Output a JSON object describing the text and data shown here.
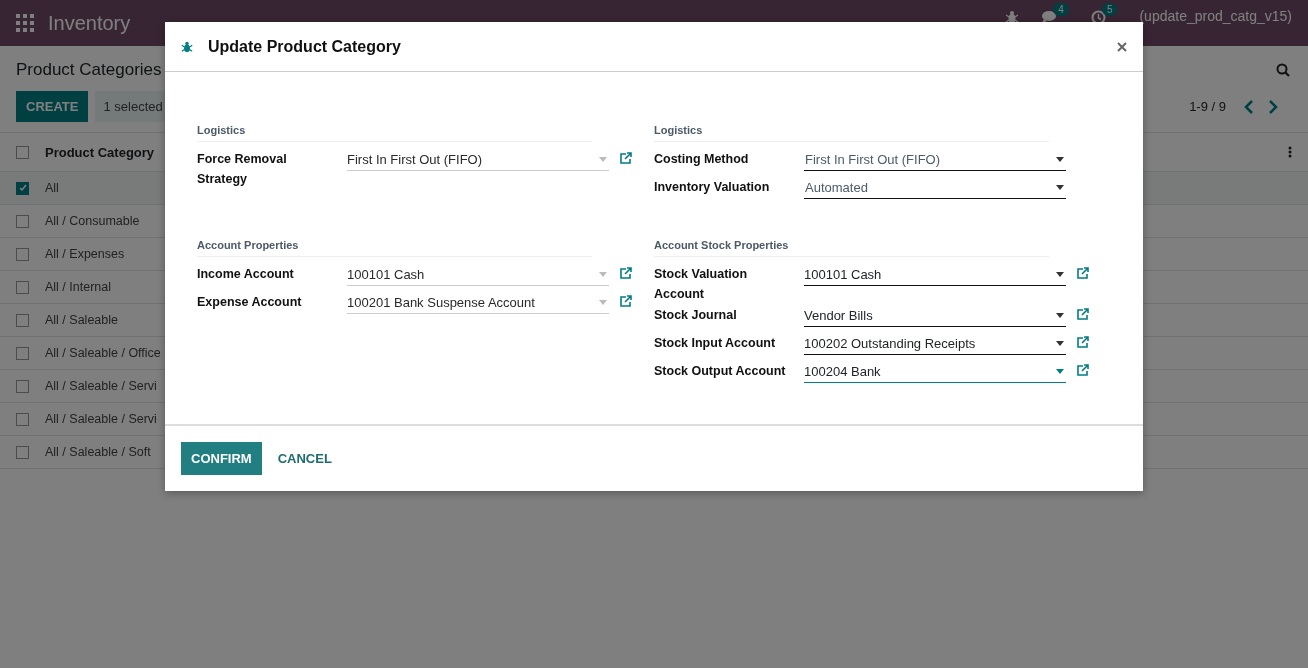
{
  "navbar": {
    "app_name": "Inventory",
    "systray": [
      {
        "kind": "debug"
      },
      {
        "kind": "chat",
        "badge": "4"
      },
      {
        "kind": "activity",
        "badge": "5"
      }
    ],
    "user": "(update_prod_catg_v15)"
  },
  "control_panel": {
    "title": "Product Categories",
    "create_button": "CREATE",
    "selection_badge": "1 selected",
    "pager": "1-9 / 9"
  },
  "list": {
    "columns": [
      "Product Category"
    ],
    "header_checked": false,
    "rows": [
      {
        "name": "All",
        "checked": true
      },
      {
        "name": "All / Consumable",
        "checked": false
      },
      {
        "name": "All / Expenses",
        "checked": false
      },
      {
        "name": "All / Internal",
        "checked": false
      },
      {
        "name": "All / Saleable",
        "checked": false
      },
      {
        "name": "All / Saleable / Office",
        "checked": false
      },
      {
        "name": "All / Saleable / Servi",
        "checked": false
      },
      {
        "name": "All / Saleable / Servi",
        "checked": false
      },
      {
        "name": "All / Saleable / Soft",
        "checked": false
      }
    ]
  },
  "dialog": {
    "title": "Update Product Category",
    "columns": [
      {
        "sections": [
          {
            "title": "Logistics",
            "fields": [
              {
                "label": "Force Removal Strategy",
                "value": "First In First Out (FIFO)",
                "kind": "many2one",
                "muted": true,
                "focused": false,
                "external_link": true
              }
            ]
          },
          {
            "title": "Account Properties",
            "fields": [
              {
                "label": "Income Account",
                "value": "100101 Cash",
                "kind": "many2one",
                "muted": true,
                "focused": false,
                "external_link": true
              },
              {
                "label": "Expense Account",
                "value": "100201 Bank Suspense Account",
                "kind": "many2one",
                "muted": true,
                "focused": false,
                "external_link": true
              }
            ]
          }
        ]
      },
      {
        "sections": [
          {
            "title": "Logistics",
            "fields": [
              {
                "label": "Costing Method",
                "value": "First In First Out (FIFO)",
                "kind": "selection",
                "muted": false,
                "focused": false,
                "external_link": false
              },
              {
                "label": "Inventory Valuation",
                "value": "Automated",
                "kind": "selection",
                "muted": false,
                "focused": false,
                "external_link": false
              }
            ]
          },
          {
            "title": "Account Stock Properties",
            "fields": [
              {
                "label": "Stock Valuation Account",
                "value": "100101 Cash",
                "kind": "many2one",
                "muted": false,
                "focused": false,
                "external_link": true
              },
              {
                "label": "Stock Journal",
                "value": "Vendor Bills",
                "kind": "many2one",
                "muted": false,
                "focused": false,
                "external_link": true
              },
              {
                "label": "Stock Input Account",
                "value": "100202 Outstanding Receipts",
                "kind": "many2one",
                "muted": false,
                "focused": false,
                "external_link": true
              },
              {
                "label": "Stock Output Account",
                "value": "100204 Bank",
                "kind": "many2one",
                "muted": false,
                "focused": true,
                "external_link": true
              }
            ]
          }
        ]
      }
    ],
    "buttons": [
      {
        "label": "CONFIRM",
        "kind": "primary"
      },
      {
        "label": "CANCEL",
        "kind": "secondary"
      }
    ]
  }
}
